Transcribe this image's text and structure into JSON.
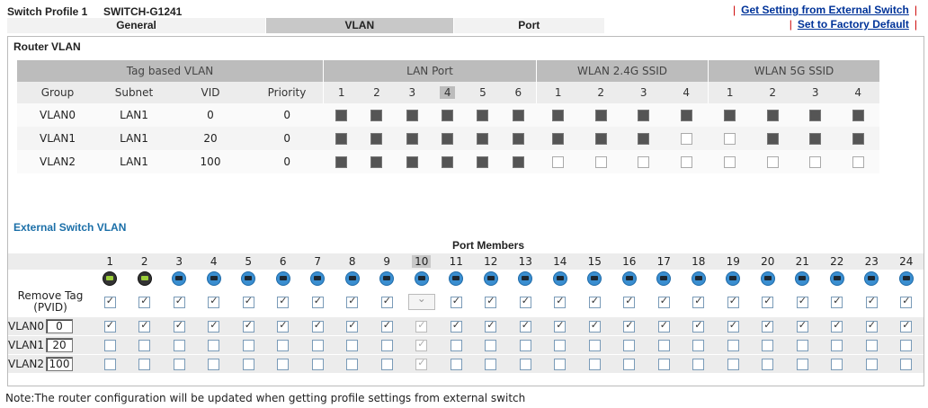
{
  "header": {
    "profile_label": "Switch Profile 1",
    "profile_model": "SWITCH-G1241",
    "link_get_setting": "Get Setting from External Switch",
    "link_factory": "Set to Factory Default",
    "separator": "|",
    "tabs": [
      {
        "label": "General",
        "active": false
      },
      {
        "label": "VLAN",
        "active": true
      },
      {
        "label": "Port",
        "active": false
      }
    ]
  },
  "router_vlan": {
    "title": "Router VLAN",
    "groups": [
      "Tag based VLAN",
      "LAN Port",
      "WLAN 2.4G SSID",
      "WLAN 5G SSID"
    ],
    "columns": [
      "Group",
      "Subnet",
      "VID",
      "Priority"
    ],
    "lan_ports": [
      "1",
      "2",
      "3",
      "4",
      "5",
      "6"
    ],
    "highlight_lan_port": "4",
    "wlan24": [
      "1",
      "2",
      "3",
      "4"
    ],
    "wlan5": [
      "1",
      "2",
      "3",
      "4"
    ],
    "rows": [
      {
        "group": "VLAN0",
        "subnet": "LAN1",
        "vid": "0",
        "priority": "0",
        "lan": [
          1,
          1,
          1,
          1,
          1,
          1
        ],
        "w24": [
          1,
          1,
          1,
          1
        ],
        "w5": [
          1,
          1,
          1,
          1
        ]
      },
      {
        "group": "VLAN1",
        "subnet": "LAN1",
        "vid": "20",
        "priority": "0",
        "lan": [
          1,
          1,
          1,
          1,
          1,
          1
        ],
        "w24": [
          1,
          1,
          1,
          0
        ],
        "w5": [
          0,
          1,
          1,
          1
        ]
      },
      {
        "group": "VLAN2",
        "subnet": "LAN1",
        "vid": "100",
        "priority": "0",
        "lan": [
          1,
          1,
          1,
          1,
          1,
          1
        ],
        "w24": [
          0,
          0,
          0,
          0
        ],
        "w5": [
          0,
          0,
          0,
          0
        ]
      }
    ]
  },
  "external_vlan": {
    "title": "External Switch VLAN",
    "port_members_label": "Port Members",
    "ports": [
      "1",
      "2",
      "3",
      "4",
      "5",
      "6",
      "7",
      "8",
      "9",
      "10",
      "11",
      "12",
      "13",
      "14",
      "15",
      "16",
      "17",
      "18",
      "19",
      "20",
      "21",
      "22",
      "23",
      "24"
    ],
    "highlight_port": "10",
    "link_up_ports": [
      "1",
      "2"
    ],
    "remove_tag_label_1": "Remove Tag",
    "remove_tag_label_2": "(PVID)",
    "vlans": [
      {
        "name": "VLAN0",
        "vid": "0",
        "members": [
          1,
          1,
          1,
          1,
          1,
          1,
          1,
          1,
          1,
          1,
          1,
          1,
          1,
          1,
          1,
          1,
          1,
          1,
          1,
          1,
          1,
          1,
          1,
          1
        ]
      },
      {
        "name": "VLAN1",
        "vid": "20",
        "members": [
          0,
          0,
          0,
          0,
          0,
          0,
          0,
          0,
          0,
          1,
          0,
          0,
          0,
          0,
          0,
          0,
          0,
          0,
          0,
          0,
          0,
          0,
          0,
          0
        ]
      },
      {
        "name": "VLAN2",
        "vid": "100",
        "members": [
          0,
          0,
          0,
          0,
          0,
          0,
          0,
          0,
          0,
          1,
          0,
          0,
          0,
          0,
          0,
          0,
          0,
          0,
          0,
          0,
          0,
          0,
          0,
          0
        ]
      }
    ]
  },
  "note": "Note:The router configuration will be updated when getting profile settings from external switch"
}
